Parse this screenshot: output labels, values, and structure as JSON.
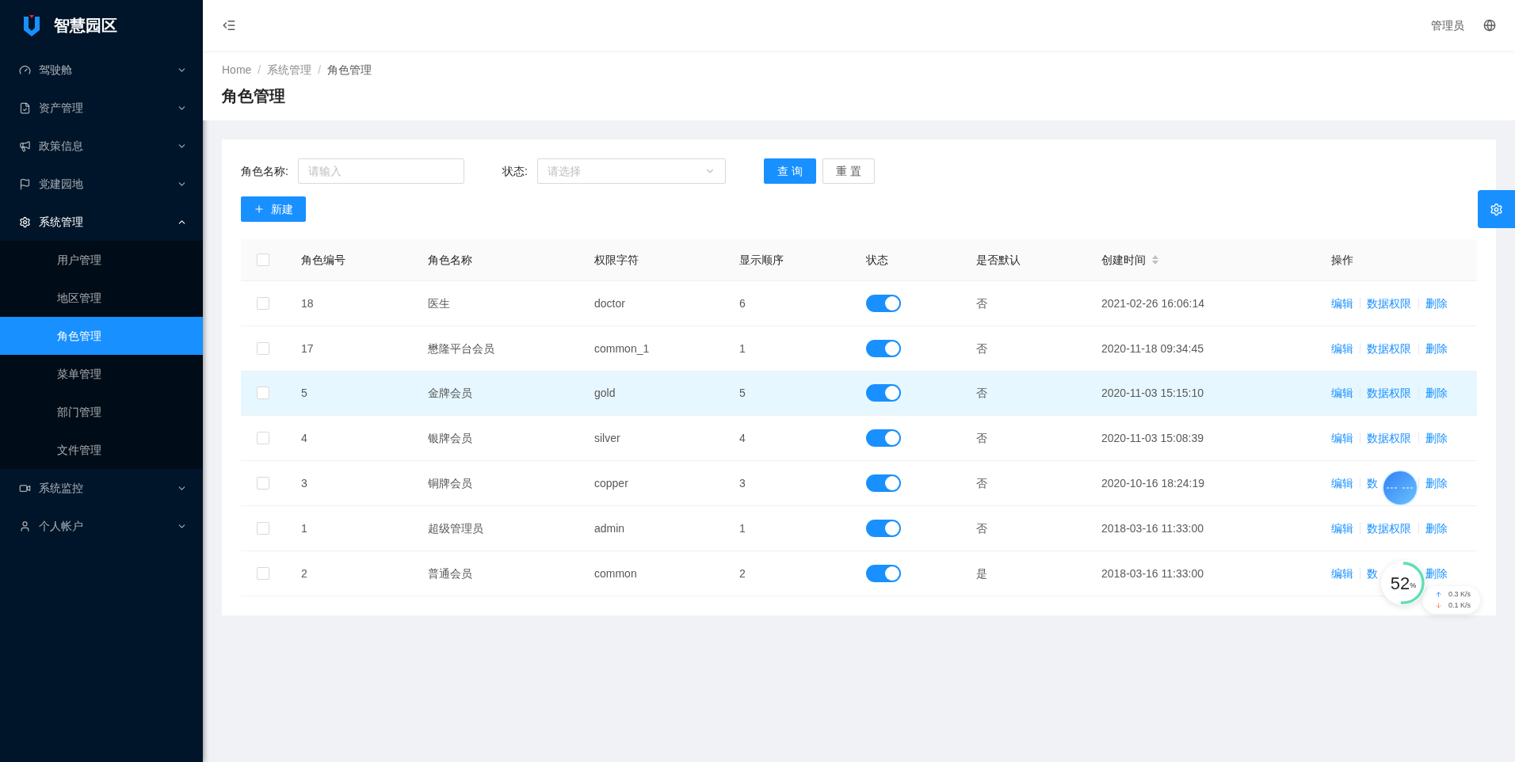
{
  "logo": {
    "title": "智慧园区"
  },
  "sidebar": {
    "items": [
      {
        "label": "驾驶舱",
        "expanded": false
      },
      {
        "label": "资产管理",
        "expanded": false
      },
      {
        "label": "政策信息",
        "expanded": false
      },
      {
        "label": "党建园地",
        "expanded": false
      },
      {
        "label": "系统管理",
        "expanded": true,
        "children": [
          {
            "label": "用户管理",
            "selected": false
          },
          {
            "label": "地区管理",
            "selected": false
          },
          {
            "label": "角色管理",
            "selected": true
          },
          {
            "label": "菜单管理",
            "selected": false
          },
          {
            "label": "部门管理",
            "selected": false
          },
          {
            "label": "文件管理",
            "selected": false
          }
        ]
      },
      {
        "label": "系统监控",
        "expanded": false
      },
      {
        "label": "个人帐户",
        "expanded": false
      }
    ]
  },
  "header": {
    "user": "管理员"
  },
  "breadcrumb": {
    "separator": "/",
    "items": [
      "Home",
      "系统管理",
      "角色管理"
    ]
  },
  "page_title": "角色管理",
  "filters": [
    {
      "label": "角色名称:",
      "kind": "input",
      "placeholder": "请输入"
    },
    {
      "label": "状态:",
      "kind": "select",
      "placeholder": "请选择"
    }
  ],
  "buttons": [
    {
      "label": "查 询",
      "kind": "primary"
    },
    {
      "label": "重 置",
      "kind": "default"
    }
  ],
  "new_button": {
    "label": "新建"
  },
  "table": {
    "header_checked": false,
    "columns": [
      {
        "label": "角色编号"
      },
      {
        "label": "角色名称"
      },
      {
        "label": "权限字符"
      },
      {
        "label": "显示顺序"
      },
      {
        "label": "状态"
      },
      {
        "label": "是否默认"
      },
      {
        "label": "创建时间",
        "sortable": true
      },
      {
        "label": "操作"
      }
    ],
    "rows": [
      {
        "checked": false,
        "highlighted": false,
        "id": "18",
        "name": "医生",
        "key": "doctor",
        "order": "6",
        "enabled": true,
        "default": "否",
        "created": "2021-02-26 16:06:14",
        "actions": [
          "编辑",
          "数据权限",
          "删除"
        ]
      },
      {
        "checked": false,
        "highlighted": false,
        "id": "17",
        "name": "懋隆平台会员",
        "key": "common_1",
        "order": "1",
        "enabled": true,
        "default": "否",
        "created": "2020-11-18 09:34:45",
        "actions": [
          "编辑",
          "数据权限",
          "删除"
        ]
      },
      {
        "checked": false,
        "highlighted": true,
        "id": "5",
        "name": "金牌会员",
        "key": "gold",
        "order": "5",
        "enabled": true,
        "default": "否",
        "created": "2020-11-03 15:15:10",
        "actions": [
          "编辑",
          "数据权限",
          "删除"
        ]
      },
      {
        "checked": false,
        "highlighted": false,
        "id": "4",
        "name": "银牌会员",
        "key": "silver",
        "order": "4",
        "enabled": true,
        "default": "否",
        "created": "2020-11-03 15:08:39",
        "actions": [
          "编辑",
          "数据权限",
          "删除"
        ]
      },
      {
        "checked": false,
        "highlighted": false,
        "id": "3",
        "name": "铜牌会员",
        "key": "copper",
        "order": "3",
        "enabled": true,
        "default": "否",
        "created": "2020-10-16 18:24:19",
        "actions": [
          "编辑",
          "数",
          "删除"
        ]
      },
      {
        "checked": false,
        "highlighted": false,
        "id": "1",
        "name": "超级管理员",
        "key": "admin",
        "order": "1",
        "enabled": true,
        "default": "否",
        "created": "2018-03-16 11:33:00",
        "actions": [
          "编辑",
          "数据权限",
          "删除"
        ]
      },
      {
        "checked": false,
        "highlighted": false,
        "id": "2",
        "name": "普通会员",
        "key": "common",
        "order": "2",
        "enabled": true,
        "default": "是",
        "created": "2018-03-16 11:33:00",
        "actions": [
          "编辑",
          "数",
          "删除"
        ]
      }
    ]
  },
  "speed_monitor": {
    "percent": "52",
    "unit": "%",
    "level": 0.52,
    "upload": "0.3 K/s",
    "download": "0.1 K/s"
  }
}
